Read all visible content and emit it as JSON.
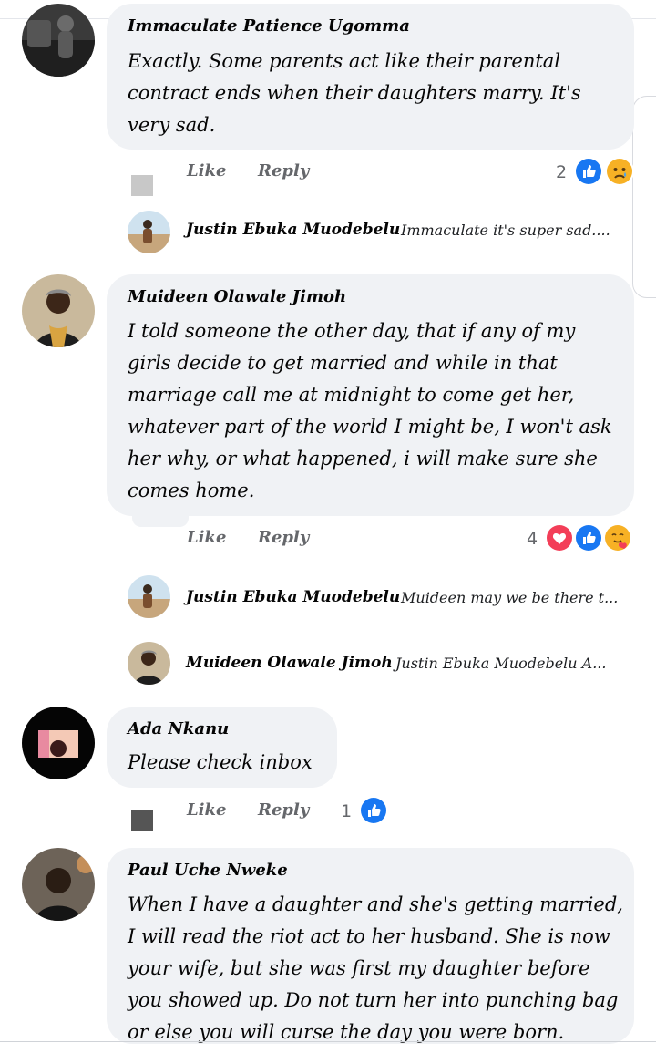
{
  "comments": [
    {
      "author": "Immaculate Patience Ugomma",
      "lines": [
        "Exactly. Some parents act like their parental",
        "contract ends when their daughters marry. It's",
        "very sad."
      ],
      "like_label": "Like",
      "reply_label": "Reply",
      "reaction_count": "2",
      "reactions": [
        "like-icon",
        "sad-icon"
      ],
      "replies": [
        {
          "name": "Justin Ebuka Muodebelu",
          "snippet": "Immaculate it's super sad...."
        }
      ]
    },
    {
      "author": "Muideen Olawale Jimoh",
      "lines": [
        "I told someone the other day, that if any of my",
        "girls decide to get married and while in that",
        "marriage call me at midnight to come get her,",
        "whatever part of the world I might be, I won't ask",
        "her why, or what happened, i will make sure she",
        "comes home."
      ],
      "like_label": "Like",
      "reply_label": "Reply",
      "reaction_count": "4",
      "reactions": [
        "love-icon",
        "like-icon",
        "care-icon"
      ],
      "replies": [
        {
          "name": "Justin Ebuka Muodebelu",
          "snippet": "Muideen may we be there t..."
        },
        {
          "name": "Muideen Olawale Jimoh",
          "snippet": "Justin Ebuka Muodebelu A..."
        }
      ]
    },
    {
      "author": "Ada Nkanu",
      "lines": [
        "Please check inbox"
      ],
      "like_label": "Like",
      "reply_label": "Reply",
      "reaction_count": "1",
      "reactions": [
        "like-icon"
      ]
    },
    {
      "author": "Paul Uche Nweke",
      "lines": [
        "When I have a daughter and she's getting married,",
        "I will read the riot act to her husband. She is now",
        "your wife, but she was first my daughter before",
        "you showed up. Do not turn her into punching bag",
        "or else you will curse the day you were born."
      ]
    }
  ],
  "colors": {
    "bubble": "#f0f2f5",
    "meta": "#65676b",
    "like_blue": "#1877f2",
    "love_red": "#f33e58",
    "haha_yellow": "#f7b125"
  }
}
